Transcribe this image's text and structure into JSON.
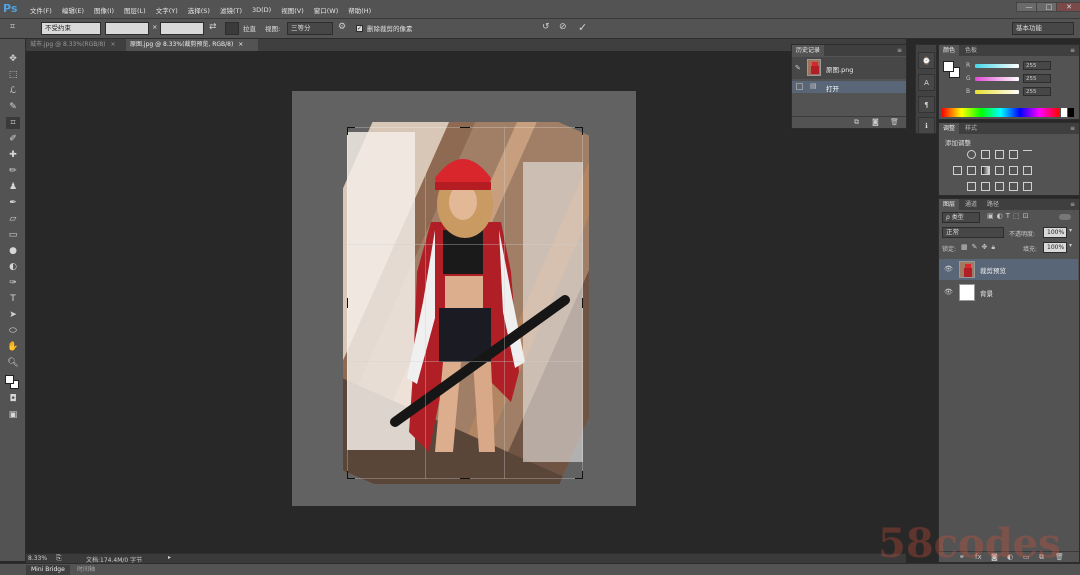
{
  "app": {
    "logo": "Ps"
  },
  "menu": [
    "文件(F)",
    "编辑(E)",
    "图像(I)",
    "图层(L)",
    "文字(Y)",
    "选择(S)",
    "滤镜(T)",
    "3D(D)",
    "视图(V)",
    "窗口(W)",
    "帮助(H)"
  ],
  "window_controls": {
    "minimize": "—",
    "maximize": "□",
    "close": "✕"
  },
  "workspace": {
    "label": "基本功能"
  },
  "options": {
    "ratio_preset": "不受约束",
    "width_value": "",
    "height_value": "",
    "x_separator": "×",
    "straighten_label": "拉直",
    "view_label": "视图:",
    "view_value": "三等分",
    "delete_cropped_label": "删除裁剪的像素",
    "cancel_icon": "⊘",
    "commit_icon": "✓",
    "reset_icon": "↺"
  },
  "tabs": [
    {
      "label": "城市.jpg @ 8.33%(RGB/8)",
      "close": "×",
      "active": false
    },
    {
      "label": "原图.jpg @ 8.33%(裁剪预览, RGB/8)",
      "close": "×",
      "active": true
    }
  ],
  "status": {
    "zoom": "8.33%",
    "doc_info": "文档:174.4M/0 字节"
  },
  "bottom_tabs": [
    "Mini Bridge",
    "时间轴"
  ],
  "history": {
    "title": "历史记录",
    "snapshot": "原图.png",
    "items": [
      "打开"
    ]
  },
  "color_panel": {
    "tabs": [
      "颜色",
      "色板"
    ],
    "channels": [
      {
        "label": "R",
        "value": "255",
        "color": "#3ecfe0"
      },
      {
        "label": "G",
        "value": "255",
        "color": "#e04ad4"
      },
      {
        "label": "B",
        "value": "255",
        "color": "#e8e030"
      }
    ]
  },
  "adjustments": {
    "tabs": [
      "调整",
      "样式"
    ],
    "title": "添加调整"
  },
  "layers": {
    "tabs": [
      "图层",
      "通道",
      "路径"
    ],
    "kind_label": "ρ 类型",
    "blend_mode": "正常",
    "opacity_label": "不透明度:",
    "opacity_value": "100%",
    "lock_label": "锁定:",
    "fill_label": "填充:",
    "fill_value": "100%",
    "items": [
      {
        "name": "裁剪预览",
        "selected": true
      },
      {
        "name": "背景",
        "selected": false
      }
    ]
  },
  "watermark": "58codes",
  "colors": {
    "accent": "#4fa3e0",
    "selection": "#596678",
    "jacket_red": "#c8262e"
  }
}
